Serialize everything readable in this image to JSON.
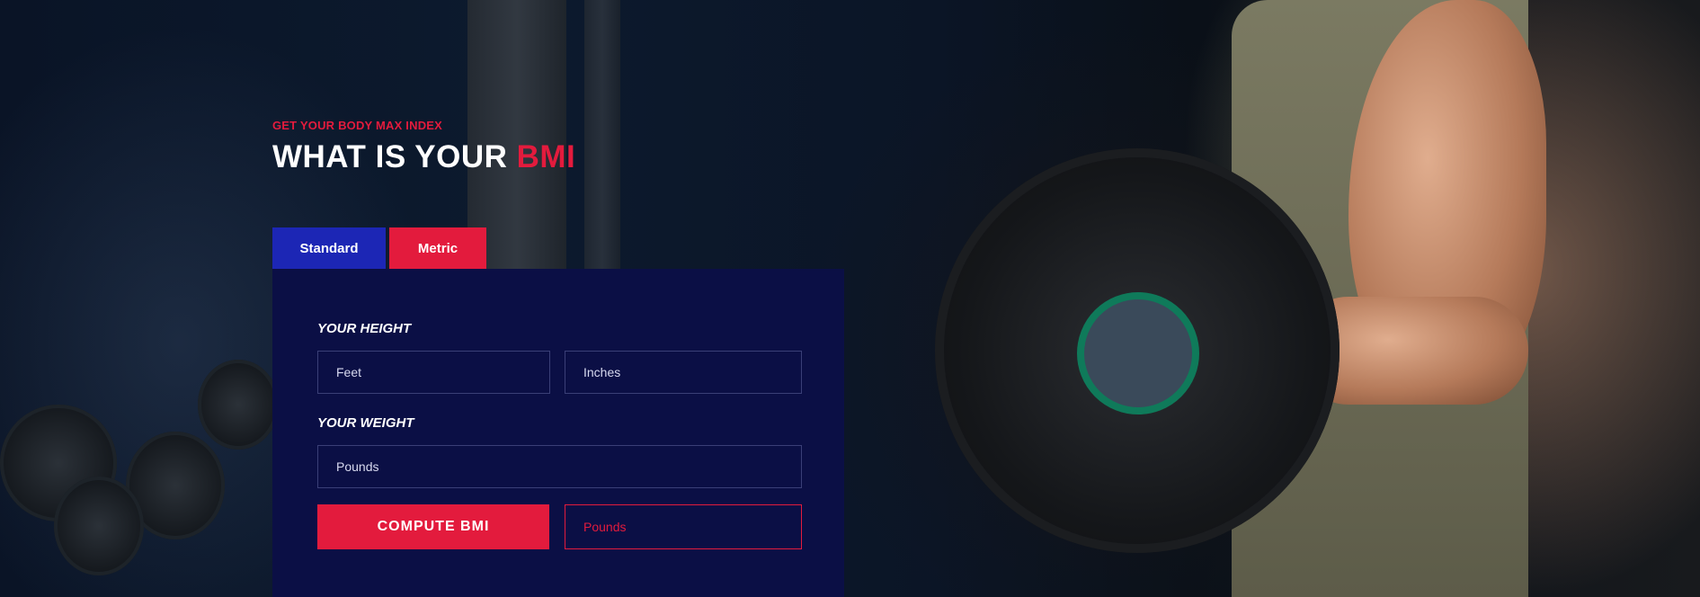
{
  "hero": {
    "subtitle": "GET YOUR BODY MAX INDEX",
    "title_main": "WHAT IS YOUR",
    "title_accent": "BMI"
  },
  "tabs": [
    {
      "label": "Standard",
      "color": "#1c26b5"
    },
    {
      "label": "Metric",
      "color": "#e31b3d"
    }
  ],
  "form": {
    "height_label": "YOUR HEIGHT",
    "feet_placeholder": "Feet",
    "inches_placeholder": "Inches",
    "weight_label": "YOUR WEIGHT",
    "pounds_placeholder": "Pounds",
    "compute_label": "COMPUTE BMI",
    "result_placeholder": "Pounds"
  },
  "colors": {
    "accent": "#e31b3d",
    "panel": "#0b0f45",
    "tab_active": "#1c26b5"
  }
}
